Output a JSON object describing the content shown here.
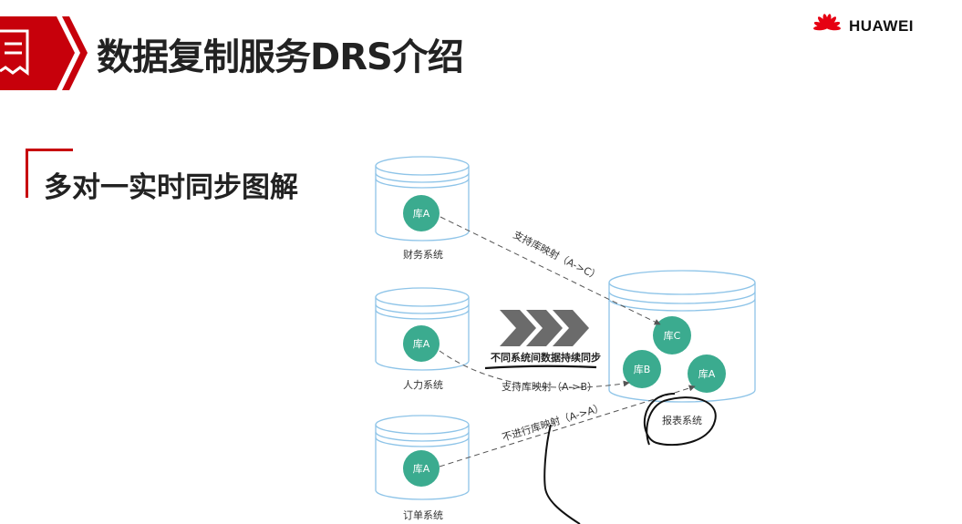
{
  "header": {
    "title": "数据复制服务DRS介绍",
    "brand": "HUAWEI"
  },
  "section": {
    "title": "多对一实时同步图解"
  },
  "diagram": {
    "sources": [
      {
        "system": "财务系统",
        "db": "库A"
      },
      {
        "system": "人力系统",
        "db": "库A"
      },
      {
        "system": "订单系统",
        "db": "库A"
      }
    ],
    "target": {
      "system": "报表系统",
      "dbs": [
        "库C",
        "库B",
        "库A"
      ]
    },
    "sync_label": "不同系统间数据持续同步",
    "mappings": [
      "支持库映射（A->C）",
      "支持库映射（A->B）",
      "不进行库映射（A->A）"
    ]
  },
  "colors": {
    "brand_red": "#c7000b",
    "db_green": "#3bab8f",
    "cylinder_stroke": "#8ec4e8",
    "arrow_gray": "#555555"
  }
}
